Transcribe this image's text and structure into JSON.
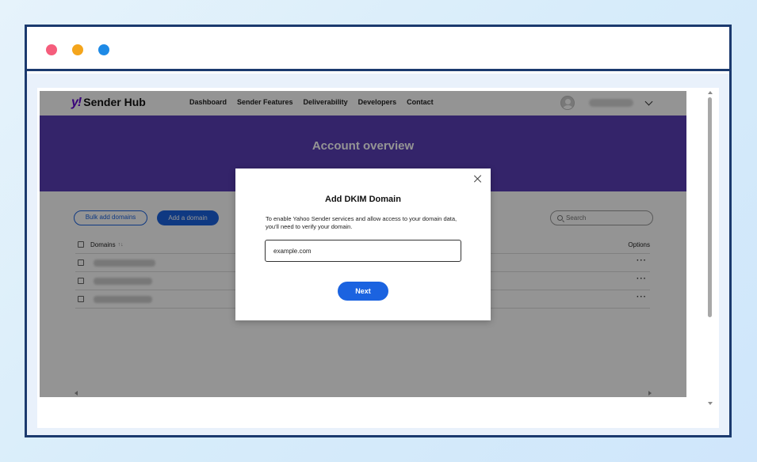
{
  "browser": {
    "window_controls": [
      "close",
      "minimize",
      "maximize"
    ]
  },
  "nav": {
    "logo_mark": "y!",
    "logo_text": "Sender Hub",
    "links": [
      "Dashboard",
      "Sender Features",
      "Deliverability",
      "Developers",
      "Contact"
    ]
  },
  "hero": {
    "title": "Account overview"
  },
  "toolbar": {
    "bulk_add_label": "Bulk add domains",
    "add_domain_label": "Add a domain",
    "search_placeholder": "Search"
  },
  "table": {
    "columns": [
      "Domains",
      "Options"
    ],
    "sort_indicator": "↑↓",
    "row_options_glyph": "···"
  },
  "modal": {
    "title": "Add DKIM Domain",
    "description": "To enable Yahoo Sender services and allow access to your domain data, you'll need to verify your domain.",
    "input_value": "example.com",
    "next_label": "Next"
  },
  "colors": {
    "hero": "#5b3fb7",
    "accent": "#1b63e0",
    "frame_border": "#1b3a6e",
    "brand": "#6001d2"
  }
}
